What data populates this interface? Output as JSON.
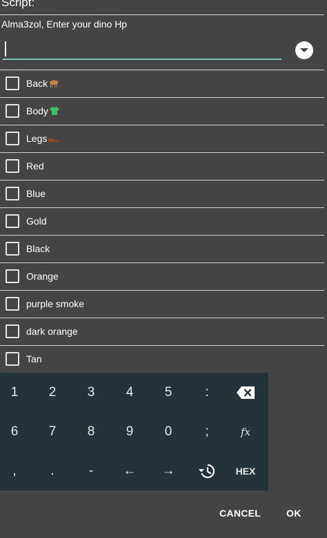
{
  "dialog": {
    "title": "Script:",
    "prompt": "Alma3zol, Enter your dino Hp",
    "input_value": ""
  },
  "options": [
    {
      "label": "Back",
      "icon": "camel-icon",
      "checked": false
    },
    {
      "label": "Body",
      "icon": "shirt-icon",
      "checked": false
    },
    {
      "label": "Legs",
      "icon": "shoe-icon",
      "checked": false
    },
    {
      "label": "Red",
      "checked": false
    },
    {
      "label": "Blue",
      "checked": false
    },
    {
      "label": "Gold",
      "checked": false
    },
    {
      "label": "Black",
      "checked": false
    },
    {
      "label": "Orange",
      "checked": false
    },
    {
      "label": "purple smoke",
      "checked": false
    },
    {
      "label": "dark orange",
      "checked": false
    },
    {
      "label": "Tan",
      "checked": false
    }
  ],
  "keyboard": {
    "row1": [
      "1",
      "2",
      "3",
      "4",
      "5",
      ":"
    ],
    "row2": [
      "6",
      "7",
      "8",
      "9",
      "0",
      ";",
      "fx"
    ],
    "row3": [
      ",",
      ".",
      "-",
      "←",
      "→"
    ],
    "hex_label": "HEX"
  },
  "buttons": {
    "cancel": "CANCEL",
    "ok": "OK"
  },
  "colors": {
    "background": "#444444",
    "keyboard": "#25323a",
    "accent_underline": "#7fc8c2"
  }
}
